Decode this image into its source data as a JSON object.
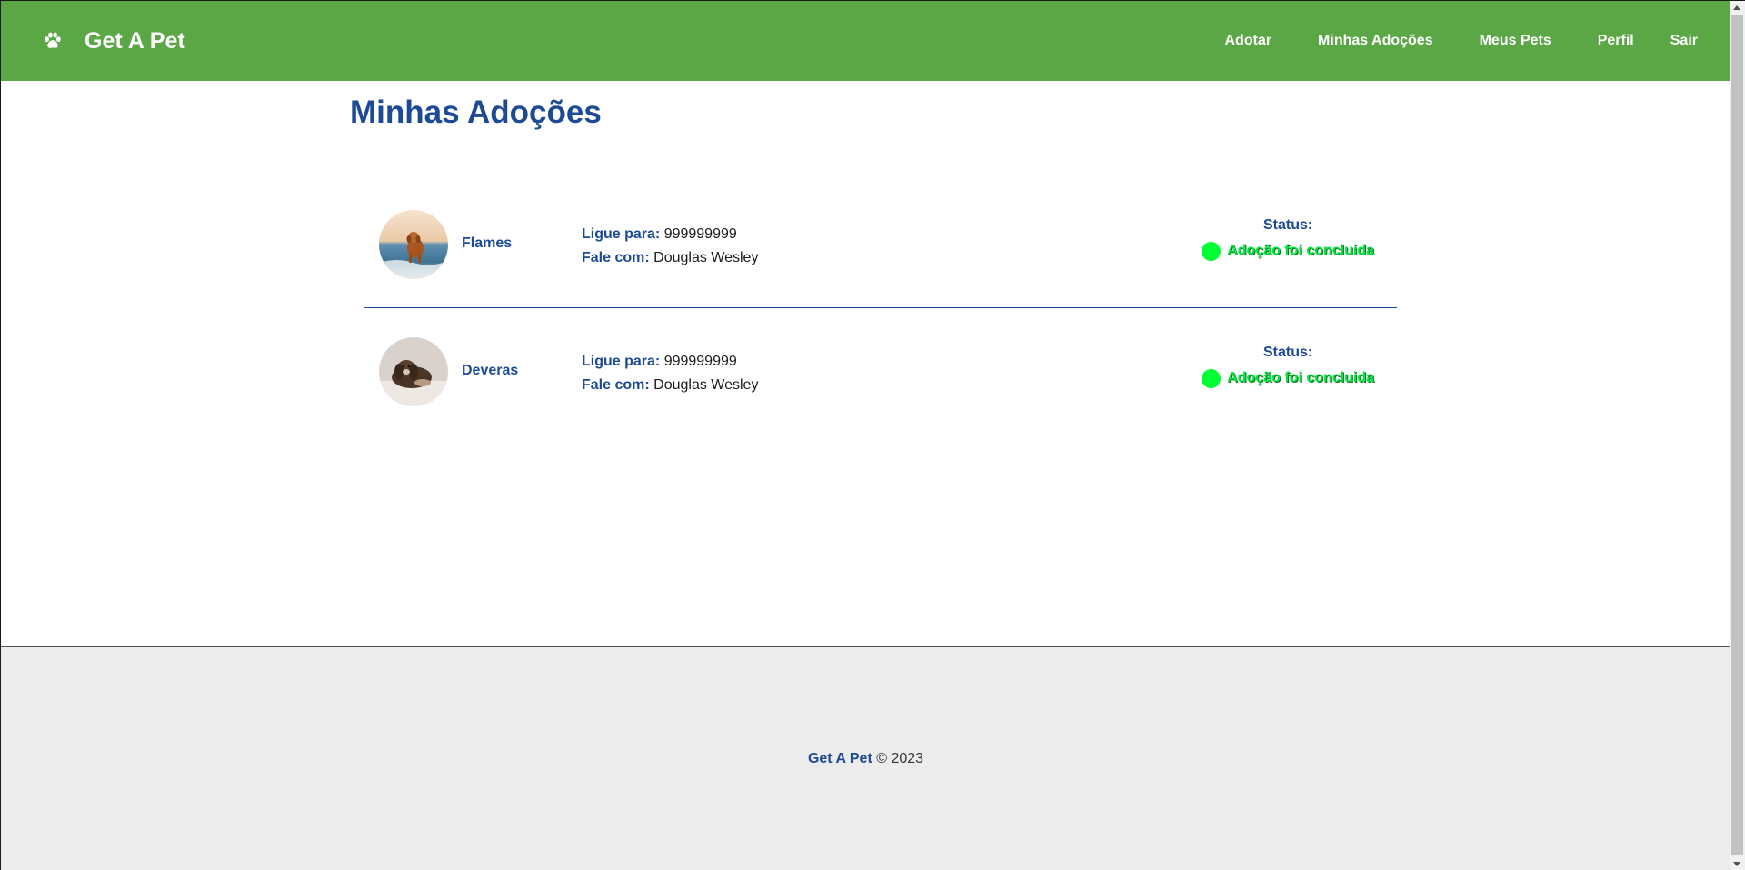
{
  "navbar": {
    "brand": "Get A Pet",
    "brand_icon": "paw-icon",
    "links": [
      "Adotar",
      "Minhas Adoções",
      "Meus Pets",
      "Perfil",
      "Sair"
    ]
  },
  "main": {
    "title": "Minhas Adoções",
    "adoptions": [
      {
        "name": "Flames",
        "phone_label": "Ligue para:",
        "phone": "999999999",
        "contact_label": "Fale com:",
        "contact": "Douglas Wesley",
        "status_label": "Status:",
        "status": "Adoção foi concluida"
      },
      {
        "name": "Deveras",
        "phone_label": "Ligue para:",
        "phone": "999999999",
        "contact_label": "Fale com:",
        "contact": "Douglas Wesley",
        "status_label": "Status:",
        "status": "Adoção foi concluida"
      }
    ]
  },
  "footer": {
    "brand": "Get A Pet",
    "copyright": "© 2023"
  },
  "colors": {
    "navbar_bg": "#5ba745",
    "primary_blue": "#1c4a94",
    "status_green": "#00e640",
    "footer_bg": "#ececec"
  }
}
